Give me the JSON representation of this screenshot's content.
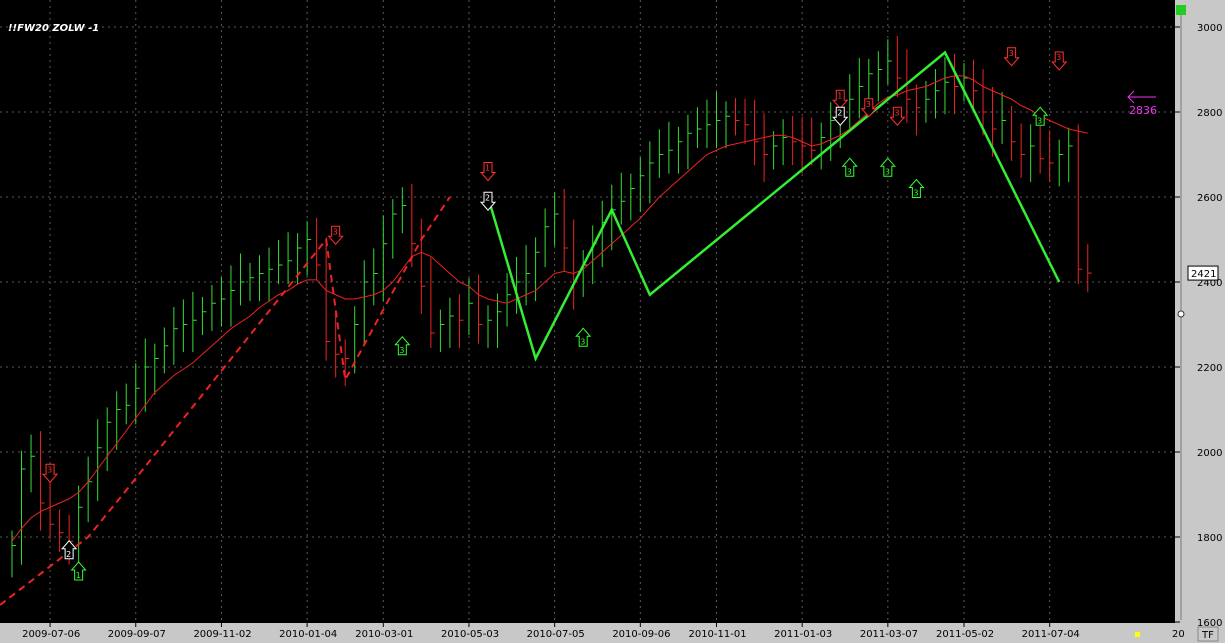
{
  "chart_data": {
    "type": "bar",
    "title": "!!FW20 ZOLW -1",
    "ylim": [
      1600,
      3020
    ],
    "yticks": [
      1600,
      1800,
      2000,
      2200,
      2400,
      2600,
      2800,
      3000
    ],
    "x_labels": [
      "2009-07-06",
      "2009-09-07",
      "2009-11-02",
      "2010-01-04",
      "2010-03-01",
      "2010-05-03",
      "2010-07-05",
      "2010-09-06",
      "2010-11-01",
      "2011-01-03",
      "2011-03-07",
      "2011-05-02",
      "2011-07-04"
    ],
    "x_label_idx": [
      4,
      13,
      22,
      31,
      39,
      48,
      57,
      66,
      74,
      83,
      92,
      100,
      109
    ],
    "bar_count": 114,
    "closes": [
      1780,
      1960,
      1990,
      1880,
      1830,
      1810,
      1790,
      1870,
      1930,
      2010,
      2070,
      2100,
      2110,
      2150,
      2200,
      2220,
      2250,
      2290,
      2300,
      2310,
      2330,
      2350,
      2360,
      2380,
      2400,
      2410,
      2420,
      2430,
      2440,
      2450,
      2480,
      2500,
      2440,
      2260,
      2230,
      2220,
      2300,
      2400,
      2420,
      2490,
      2560,
      2580,
      2490,
      2390,
      2280,
      2300,
      2320,
      2310,
      2350,
      2300,
      2310,
      2330,
      2370,
      2400,
      2420,
      2470,
      2530,
      2560,
      2480,
      2400,
      2440,
      2490,
      2540,
      2570,
      2590,
      2620,
      2650,
      2680,
      2700,
      2710,
      2730,
      2750,
      2760,
      2770,
      2780,
      2790,
      2780,
      2770,
      2730,
      2700,
      2720,
      2740,
      2730,
      2720,
      2710,
      2740,
      2780,
      2790,
      2830,
      2860,
      2890,
      2900,
      2920,
      2880,
      2830,
      2810,
      2830,
      2850,
      2870,
      2860,
      2880,
      2850,
      2800,
      2760,
      2780,
      2730,
      2700,
      2720,
      2690,
      2680,
      2700,
      2720,
      2430,
      2421
    ],
    "ma_values": [
      1790,
      1820,
      1845,
      1860,
      1870,
      1880,
      1890,
      1905,
      1930,
      1960,
      1990,
      2020,
      2050,
      2080,
      2110,
      2140,
      2160,
      2180,
      2195,
      2210,
      2230,
      2250,
      2270,
      2290,
      2305,
      2320,
      2340,
      2355,
      2370,
      2380,
      2395,
      2405,
      2405,
      2380,
      2370,
      2360,
      2360,
      2365,
      2370,
      2380,
      2400,
      2430,
      2460,
      2470,
      2460,
      2440,
      2420,
      2400,
      2390,
      2370,
      2360,
      2355,
      2350,
      2360,
      2370,
      2380,
      2400,
      2420,
      2425,
      2420,
      2430,
      2450,
      2470,
      2490,
      2510,
      2530,
      2550,
      2575,
      2600,
      2620,
      2640,
      2660,
      2680,
      2700,
      2710,
      2720,
      2725,
      2730,
      2735,
      2740,
      2745,
      2745,
      2740,
      2730,
      2720,
      2725,
      2735,
      2745,
      2760,
      2780,
      2800,
      2820,
      2835,
      2840,
      2850,
      2855,
      2860,
      2870,
      2880,
      2885,
      2885,
      2875,
      2860,
      2850,
      2840,
      2830,
      2815,
      2805,
      2790,
      2780,
      2770,
      2760,
      2755,
      2750
    ],
    "zigzag_green": [
      [
        50,
        2600
      ],
      [
        55,
        2220
      ],
      [
        63,
        2570
      ],
      [
        67,
        2370
      ],
      [
        98,
        2940
      ],
      [
        110,
        2400
      ]
    ],
    "zigzag_red": [
      [
        0,
        1640
      ],
      [
        8,
        1800
      ],
      [
        12,
        1910
      ],
      [
        33,
        2500
      ],
      [
        35,
        2170
      ],
      [
        43,
        2500
      ],
      [
        46,
        2600
      ]
    ],
    "signals": [
      {
        "bar": 4,
        "label": "3",
        "dir": "down",
        "color": "#ff3030",
        "value": 1950
      },
      {
        "bar": 6,
        "label": "2",
        "dir": "up",
        "color": "#ffffff",
        "value": 1770
      },
      {
        "bar": 7,
        "label": "1",
        "dir": "up",
        "color": "#30ff30",
        "value": 1720
      },
      {
        "bar": 34,
        "label": "3",
        "dir": "down",
        "color": "#ff3030",
        "value": 2510
      },
      {
        "bar": 41,
        "label": "3",
        "dir": "up",
        "color": "#30ff30",
        "value": 2250
      },
      {
        "bar": 50,
        "label": "1",
        "dir": "down",
        "color": "#ff3030",
        "value": 2660
      },
      {
        "bar": 50,
        "label": "2",
        "dir": "down",
        "color": "#ffffff",
        "value": 2590
      },
      {
        "bar": 60,
        "label": "3",
        "dir": "up",
        "color": "#30ff30",
        "value": 2270
      },
      {
        "bar": 87,
        "label": "1",
        "dir": "down",
        "color": "#ff3030",
        "value": 2830
      },
      {
        "bar": 87,
        "label": "2",
        "dir": "down",
        "color": "#ffffff",
        "value": 2790
      },
      {
        "bar": 88,
        "label": "3",
        "dir": "up",
        "color": "#30ff30",
        "value": 2670
      },
      {
        "bar": 90,
        "label": "3",
        "dir": "down",
        "color": "#ff3030",
        "value": 2810
      },
      {
        "bar": 92,
        "label": "3",
        "dir": "up",
        "color": "#30ff30",
        "value": 2670
      },
      {
        "bar": 93,
        "label": "3",
        "dir": "down",
        "color": "#ff3030",
        "value": 2790
      },
      {
        "bar": 95,
        "label": "3",
        "dir": "up",
        "color": "#30ff30",
        "value": 2620
      },
      {
        "bar": 105,
        "label": "3",
        "dir": "down",
        "color": "#ff3030",
        "value": 2930
      },
      {
        "bar": 108,
        "label": "3",
        "dir": "up",
        "color": "#30ff30",
        "value": 2790
      },
      {
        "bar": 110,
        "label": "3",
        "dir": "down",
        "color": "#ff3030",
        "value": 2920
      }
    ],
    "target_value": 2836,
    "target_label": "2836",
    "last_price": 2421,
    "last_price_label": "2421",
    "tf_label": "TF",
    "edge_label": "20"
  },
  "colors": {
    "background": "#000000",
    "grid": "#5a5a5a",
    "up_bar": "#33dd33",
    "down_bar": "#ee2222",
    "moving_average": "#ee2222",
    "zigzag_green": "#33ee33",
    "zigzag_red": "#ee2222",
    "target": "#ee33ee",
    "axis_bg": "#c8c8c8"
  }
}
